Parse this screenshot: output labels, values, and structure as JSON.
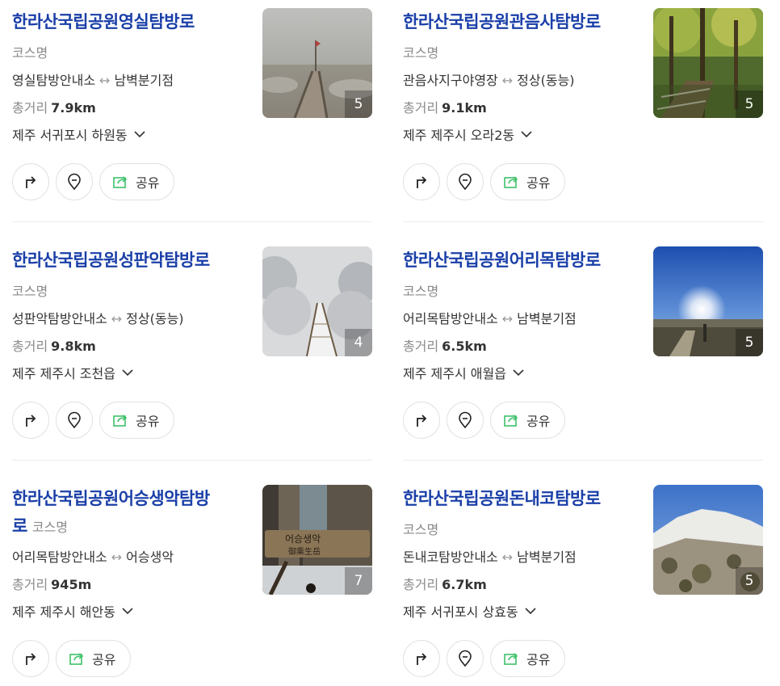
{
  "cards": [
    {
      "title": "한라산국립공원영실탐방로",
      "category": "코스명",
      "route_from": "영실탐방안내소",
      "route_arrow": "↔",
      "route_to": "남벽분기점",
      "distance_label": "총거리",
      "distance_value": "7.9km",
      "address": "제주 서귀포시 하원동",
      "photo_count": "5",
      "share_label": "공유"
    },
    {
      "title": "한라산국립공원관음사탐방로",
      "category": "코스명",
      "route_from": "관음사지구야영장",
      "route_arrow": "↔",
      "route_to": "정상(동능)",
      "distance_label": "총거리",
      "distance_value": "9.1km",
      "address": "제주 제주시 오라2동",
      "photo_count": "5",
      "share_label": "공유"
    },
    {
      "title": "한라산국립공원성판악탐방로",
      "category": "코스명",
      "route_from": "성판악탐방안내소",
      "route_arrow": "↔",
      "route_to": "정상(동능)",
      "distance_label": "총거리",
      "distance_value": "9.8km",
      "address": "제주 제주시 조천읍",
      "photo_count": "4",
      "share_label": "공유"
    },
    {
      "title": "한라산국립공원어리목탐방로",
      "category": "코스명",
      "route_from": "어리목탐방안내소",
      "route_arrow": "↔",
      "route_to": "남벽분기점",
      "distance_label": "총거리",
      "distance_value": "6.5km",
      "address": "제주 제주시 애월읍",
      "photo_count": "5",
      "share_label": "공유"
    },
    {
      "title_line1": "한라산국립공원어승생악탐방",
      "title_line2": "로",
      "category": "코스명",
      "route_from": "어리목탐방안내소",
      "route_arrow": "↔",
      "route_to": "어승생악",
      "distance_label": "총거리",
      "distance_value": "945m",
      "address": "제주 제주시 해안동",
      "photo_count": "7",
      "share_label": "공유",
      "sign_text": "어승생악",
      "sign_text_hanja": "御乘生岳"
    },
    {
      "title": "한라산국립공원돈내코탐방로",
      "category": "코스명",
      "route_from": "돈내코탐방안내소",
      "route_arrow": "↔",
      "route_to": "남벽분기점",
      "distance_label": "총거리",
      "distance_value": "6.7km",
      "address": "제주 서귀포시 상효동",
      "photo_count": "5",
      "share_label": "공유"
    }
  ],
  "colors": {
    "title": "#1a3fa8",
    "muted": "#8a8a8a",
    "share_icon": "#3ec16a"
  },
  "icons": {
    "directions": "turn-arrow-icon",
    "location": "map-pin-icon",
    "share": "share-icon",
    "expand": "chevron-down-icon"
  }
}
